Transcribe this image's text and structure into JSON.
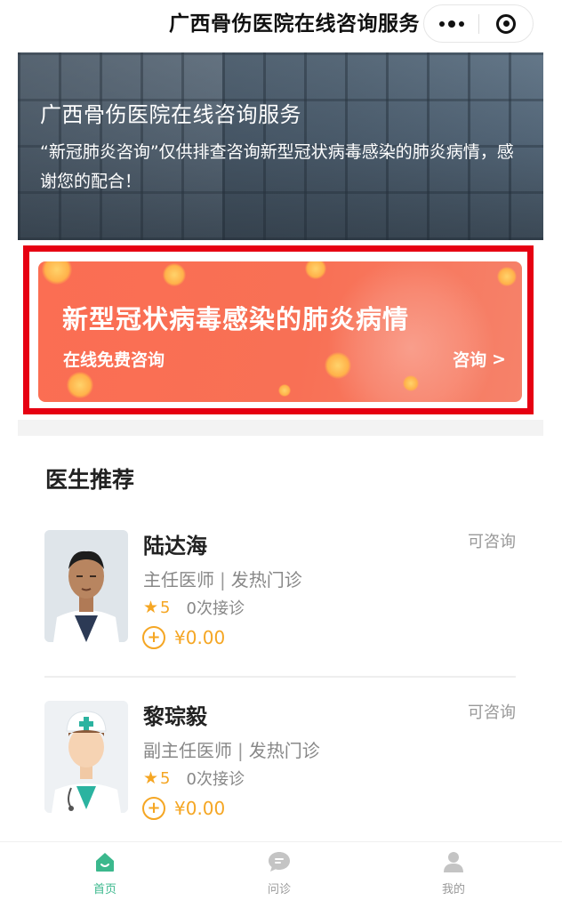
{
  "navbar": {
    "title": "广西骨伤医院在线咨询服务"
  },
  "hero": {
    "title": "广西骨伤医院在线咨询服务",
    "description": "“新冠肺炎咨询”仅供排查咨询新型冠状病毒感染的肺炎病情，感谢您的配合！"
  },
  "promo": {
    "title": "新型冠状病毒感染的肺炎病情",
    "subtitle": "在线免费咨询",
    "action": "咨询",
    "action_chevron": ">",
    "colors": {
      "outline": "#e60012",
      "card": "#fb6e53"
    }
  },
  "doctors": {
    "section_title": "医生推荐",
    "items": [
      {
        "name": "陆达海",
        "status": "可咨询",
        "title": "主任医师",
        "separator": "|",
        "department": "发热门诊",
        "rating": "5",
        "consults": "0次接诊",
        "price": "¥0.00",
        "photo_icon": "doctor-photo"
      },
      {
        "name": "黎琮毅",
        "status": "可咨询",
        "title": "副主任医师",
        "separator": "|",
        "department": "发热门诊",
        "rating": "5",
        "consults": "0次接诊",
        "price": "¥0.00",
        "photo_icon": "doctor-avatar-illustration"
      }
    ]
  },
  "tabbar": {
    "items": [
      {
        "label": "首页",
        "icon": "home-icon",
        "active": true
      },
      {
        "label": "问诊",
        "icon": "chat-icon",
        "active": false
      },
      {
        "label": "我的",
        "icon": "user-icon",
        "active": false
      }
    ],
    "colors": {
      "active": "#3bb88d",
      "inactive": "#bbbbbb"
    }
  }
}
